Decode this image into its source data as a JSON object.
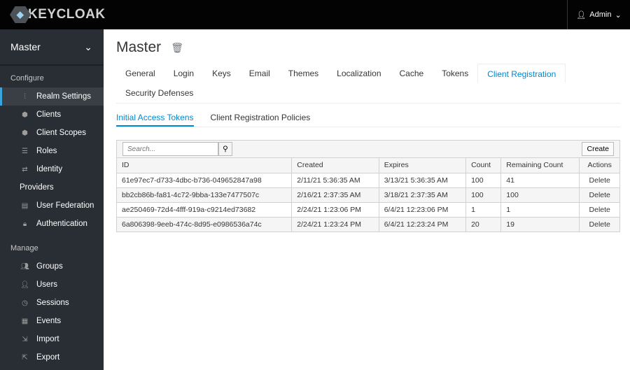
{
  "header": {
    "logo": "KEYCLOAK",
    "user": "Admin"
  },
  "sidebar": {
    "realm": "Master",
    "configure": "Configure",
    "manage": "Manage",
    "configure_items": [
      {
        "label": "Realm Settings",
        "icon": "sliders-icon"
      },
      {
        "label": "Clients",
        "icon": "cube-icon"
      },
      {
        "label": "Client Scopes",
        "icon": "cubes-icon"
      },
      {
        "label": "Roles",
        "icon": "list-icon"
      },
      {
        "label": "Identity",
        "icon": "exchange-icon"
      },
      {
        "label": "Providers",
        "icon": ""
      },
      {
        "label": "User Federation",
        "icon": "database-icon"
      },
      {
        "label": "Authentication",
        "icon": "lock-icon"
      }
    ],
    "manage_items": [
      {
        "label": "Groups",
        "icon": "users-icon"
      },
      {
        "label": "Users",
        "icon": "user-icon"
      },
      {
        "label": "Sessions",
        "icon": "clock-icon"
      },
      {
        "label": "Events",
        "icon": "calendar-icon"
      },
      {
        "label": "Import",
        "icon": "import-icon"
      },
      {
        "label": "Export",
        "icon": "export-icon"
      }
    ]
  },
  "main": {
    "title": "Master",
    "tabs": [
      "General",
      "Login",
      "Keys",
      "Email",
      "Themes",
      "Localization",
      "Cache",
      "Tokens",
      "Client Registration",
      "Security Defenses"
    ],
    "active_tab": "Client Registration",
    "subtabs": [
      "Initial Access Tokens",
      "Client Registration Policies"
    ],
    "search_placeholder": "Search...",
    "create": "Create",
    "columns": [
      "ID",
      "Created",
      "Expires",
      "Count",
      "Remaining Count",
      "Actions"
    ],
    "rows": [
      [
        "61e97ec7-d733-4dbc-b736-049652847a98",
        "2/11/21 5:36:35 AM",
        "3/13/21 5:36:35 AM",
        "100",
        "41",
        "Delete"
      ],
      [
        "bb2cb86b-fa81-4c72-9bba-133e7477507c",
        "2/16/21 2:37:35 AM",
        "3/18/21 2:37:35 AM",
        "100",
        "100",
        "Delete"
      ],
      [
        "ae250469-72d4-4fff-919a-c9214ed73682",
        "2/24/21 1:23:06 PM",
        "6/4/21 12:23:06 PM",
        "1",
        "1",
        "Delete"
      ],
      [
        "6a806398-9eeb-474c-8d95-e0986536a74c",
        "2/24/21 1:23:24 PM",
        "6/4/21 12:23:24 PM",
        "20",
        "19",
        "Delete"
      ]
    ]
  },
  "colors": {
    "accent": "#0088ce",
    "sidebar": "#292e34",
    "header": "#030303"
  }
}
